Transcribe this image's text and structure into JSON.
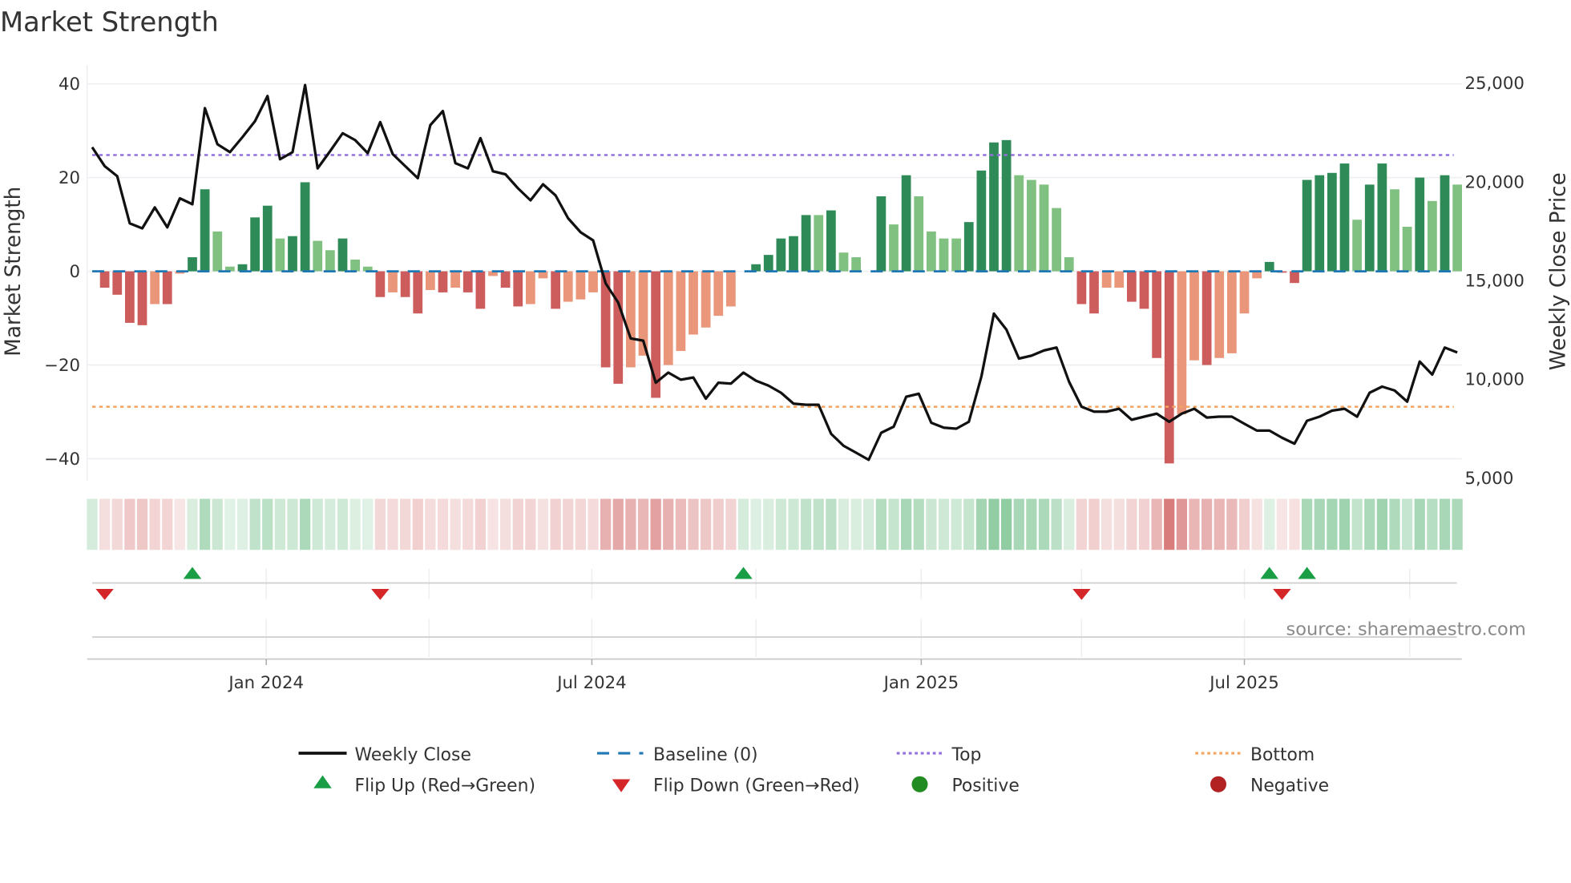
{
  "chart_data": {
    "type": "bar",
    "title": "Market Strength",
    "ylabel": "Market Strength",
    "y2label": "Weekly Close Price",
    "ylim": [
      -44.7,
      44
    ],
    "y2lim": [
      4800,
      25860
    ],
    "y_ticks": [
      {
        "v": 40,
        "label": "40"
      },
      {
        "v": 20,
        "label": "20"
      },
      {
        "v": 0,
        "label": "0"
      },
      {
        "v": -20,
        "label": "−20"
      },
      {
        "v": -40,
        "label": "−40"
      }
    ],
    "y2_ticks": [
      {
        "v": 25000,
        "label": "25,000"
      },
      {
        "v": 20000,
        "label": "20,000"
      },
      {
        "v": 15000,
        "label": "15,000"
      },
      {
        "v": 10000,
        "label": "10,000"
      },
      {
        "v": 5000,
        "label": "5,000"
      }
    ],
    "x_unit": "week index",
    "x_ticks": [
      {
        "v": 13.9,
        "label": "Jan 2024"
      },
      {
        "v": 39.9,
        "label": "Jul 2024"
      },
      {
        "v": 66.2,
        "label": "Jan 2025"
      },
      {
        "v": 92.0,
        "label": "Jul 2025"
      }
    ],
    "x_minor_ticks": [
      26.9,
      53.0,
      79.0,
      105.2
    ],
    "top_level": 24.8,
    "bottom_level": -28.9,
    "strength": [
      0,
      -3.5,
      -5,
      -11,
      -11.5,
      -7,
      -7,
      -0.5,
      3,
      17.5,
      8.5,
      1,
      1.5,
      11.5,
      14,
      7,
      7.5,
      19,
      6.5,
      4.5,
      7,
      2.5,
      1,
      -5.5,
      -4.5,
      -5.5,
      -9,
      -4,
      -4.5,
      -3.5,
      -4.5,
      -8,
      -1,
      -3.5,
      -7.5,
      -7,
      -1.5,
      -8,
      -6.5,
      -6,
      -4.5,
      -20.5,
      -24,
      -20.5,
      -18,
      -27,
      -20,
      -17,
      -13.5,
      -12,
      -9.5,
      -7.5,
      0,
      1.5,
      3.5,
      7,
      7.5,
      12,
      12,
      13,
      4,
      3,
      0,
      16,
      10,
      20.5,
      16,
      8.5,
      7,
      7,
      10.5,
      21.5,
      27.5,
      28,
      20.5,
      19.5,
      18.5,
      13.5,
      3,
      -7,
      -9,
      -3.5,
      -3.5,
      -6.5,
      -8,
      -18.5,
      -41,
      -30.5,
      -19,
      -20,
      -18.5,
      -17.5,
      -9,
      -1.5,
      2,
      -0.3,
      -2.5,
      19.5,
      20.5,
      21,
      23,
      11,
      18.5,
      23,
      17.5,
      9.5,
      20,
      15,
      20.5,
      18.5
    ],
    "strength_weakening": [
      0,
      0,
      0,
      0,
      0,
      1,
      0,
      1,
      0,
      0,
      1,
      1,
      0,
      0,
      0,
      1,
      0,
      0,
      1,
      1,
      0,
      1,
      1,
      0,
      1,
      0,
      0,
      1,
      0,
      1,
      0,
      0,
      1,
      0,
      0,
      1,
      1,
      0,
      1,
      1,
      1,
      0,
      0,
      1,
      1,
      0,
      1,
      1,
      1,
      1,
      1,
      1,
      0,
      0,
      0,
      0,
      0,
      0,
      1,
      0,
      1,
      1,
      0,
      0,
      1,
      0,
      1,
      1,
      1,
      1,
      0,
      0,
      0,
      0,
      1,
      1,
      1,
      1,
      1,
      0,
      0,
      1,
      1,
      0,
      0,
      0,
      0,
      1,
      1,
      0,
      1,
      1,
      1,
      1,
      0,
      0,
      0,
      0,
      0,
      0,
      0,
      1,
      0,
      0,
      1,
      1,
      0,
      1,
      0,
      1
    ],
    "weekly_close": [
      21700,
      20740,
      20230,
      17840,
      17590,
      18650,
      17640,
      19110,
      18810,
      23680,
      21850,
      21450,
      22210,
      23020,
      24290,
      21090,
      21450,
      24850,
      20630,
      21500,
      22410,
      22060,
      21400,
      22970,
      21350,
      20740,
      20130,
      22820,
      23530,
      20890,
      20630,
      22160,
      20480,
      20330,
      19620,
      19010,
      19820,
      19260,
      18100,
      17390,
      16980,
      14800,
      13830,
      12010,
      11900,
      9770,
      10280,
      9920,
      10030,
      8960,
      9770,
      9720,
      10280,
      9870,
      9620,
      9260,
      8710,
      8650,
      8650,
      7180,
      6570,
      6220,
      5860,
      7230,
      7540,
      9060,
      9210,
      7740,
      7490,
      7440,
      7790,
      10080,
      13270,
      12460,
      10990,
      11140,
      11400,
      11550,
      9820,
      8550,
      8300,
      8300,
      8450,
      7890,
      8050,
      8200,
      7790,
      8200,
      8450,
      8000,
      8050,
      8050,
      7690,
      7340,
      7340,
      6980,
      6680,
      7840,
      8050,
      8350,
      8450,
      8050,
      9260,
      9570,
      9370,
      8810,
      10840,
      10180,
      11550,
      11300
    ],
    "flip_up_weeks": [
      8,
      52,
      94,
      97
    ],
    "flip_down_weeks": [
      1,
      23,
      79,
      95
    ],
    "legend": {
      "weekly_close": "Weekly Close",
      "baseline": "Baseline (0)",
      "top": "Top",
      "bottom": "Bottom",
      "flip_up": "Flip Up (Red→Green)",
      "flip_down": "Flip Down (Green→Red)",
      "positive": "Positive",
      "negative": "Negative"
    },
    "legend_placement": "bottom",
    "source": "source: sharemaestro.com",
    "colors": {
      "strong_green": "#2e8b57",
      "weak_green": "#80c080",
      "strong_red": "#cd5c5c",
      "weak_red": "#e9967a",
      "line": "#111111",
      "baseline": "#1f77b4",
      "top": "#9370db",
      "bottom": "#f4a460",
      "flip_up": "#1a9e45",
      "flip_down": "#d62728",
      "positive": "#228b22",
      "negative": "#b22222",
      "grid": "#eceef2"
    }
  }
}
